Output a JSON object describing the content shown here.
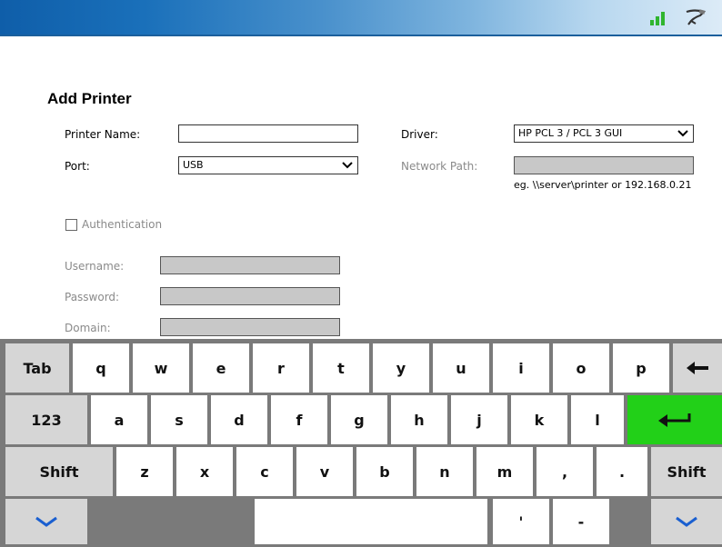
{
  "form": {
    "title": "Add Printer",
    "printer_name_label": "Printer Name:",
    "printer_name_value": "",
    "driver_label": "Driver:",
    "driver_value": "HP PCL 3 / PCL 3 GUI",
    "port_label": "Port:",
    "port_value": "USB",
    "network_path_label": "Network Path:",
    "network_path_value": "",
    "network_path_hint": "eg. \\\\server\\printer or 192.168.0.21",
    "authentication_label": "Authentication",
    "authentication_checked": false,
    "username_label": "Username:",
    "password_label": "Password:",
    "domain_label": "Domain:"
  },
  "status_icons": [
    "signal-strength-icon",
    "usb-connection-icon"
  ],
  "keyboard": {
    "row1": [
      "Tab",
      "q",
      "w",
      "e",
      "r",
      "t",
      "y",
      "u",
      "i",
      "o",
      "p",
      "backspace"
    ],
    "row2": [
      "123",
      "a",
      "s",
      "d",
      "f",
      "g",
      "h",
      "j",
      "k",
      "l",
      "enter"
    ],
    "row3": [
      "Shift",
      "z",
      "x",
      "c",
      "v",
      "b",
      "n",
      "m",
      ",",
      ".",
      "Shift"
    ],
    "row4": [
      "hide",
      "space",
      "'",
      "-",
      "hide"
    ],
    "colors": {
      "key": "#ffffff",
      "modifier": "#d6d6d6",
      "enter": "#22d018",
      "background": "#7a7a7a",
      "chevron": "#1a5fd0"
    }
  }
}
